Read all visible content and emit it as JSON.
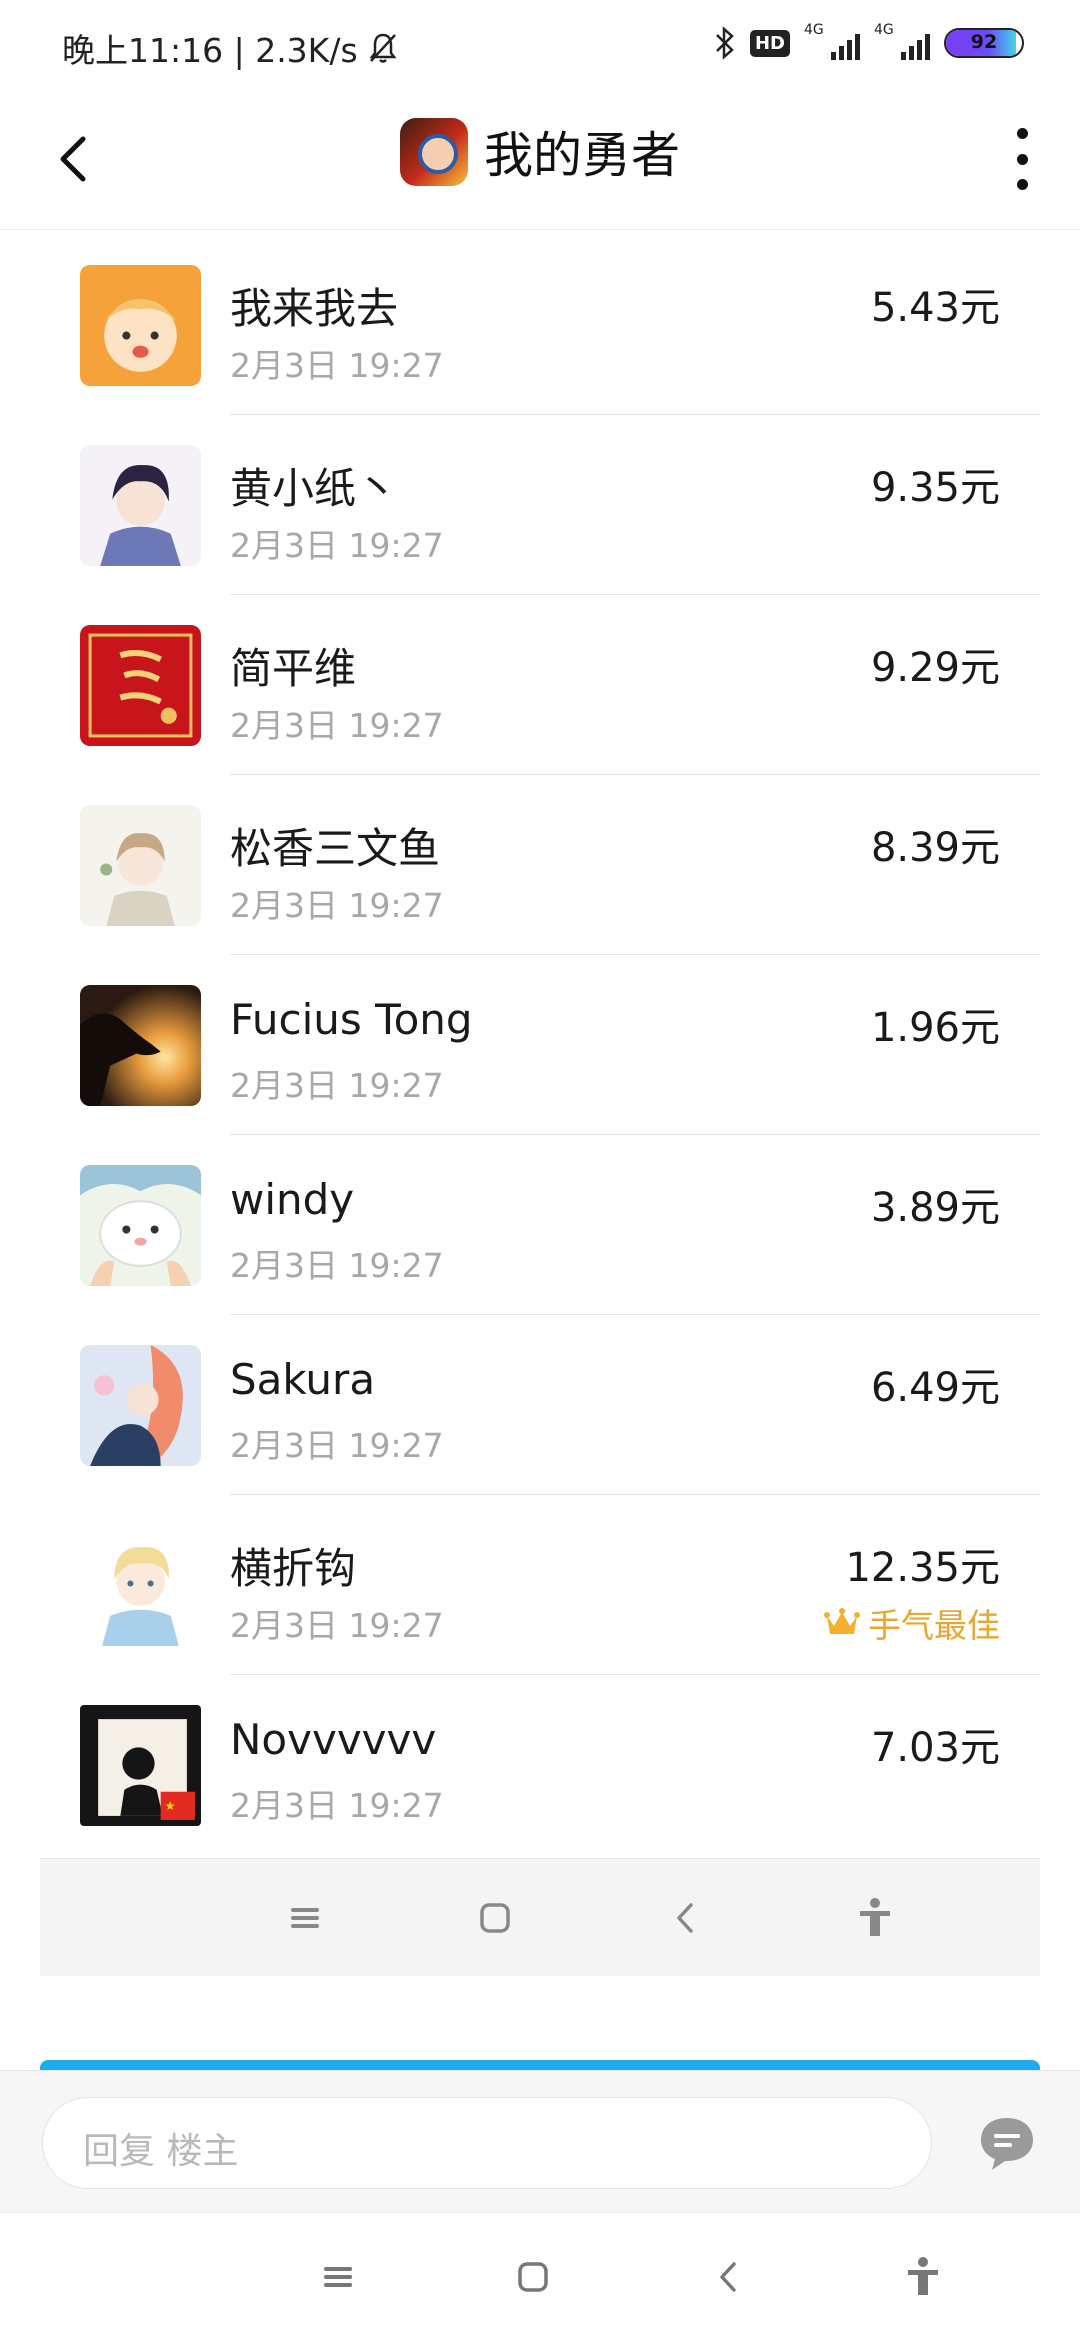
{
  "status_bar": {
    "time_speed": "晚上11:16 | 2.3K/s",
    "hd_label": "HD",
    "sim1_label": "4G",
    "sim2_label": "4G",
    "battery_level": "92",
    "icons": [
      "mute-bell-icon",
      "bluetooth-icon",
      "signal-icon",
      "battery-icon"
    ]
  },
  "header": {
    "title": "我的勇者",
    "back_icon": "chevron-left-icon",
    "more_icon": "more-vertical-icon"
  },
  "list": [
    {
      "name": "我来我去",
      "time": "2月3日  19:27",
      "amount": "5.43元"
    },
    {
      "name": "黄小纸丶",
      "time": "2月3日  19:27",
      "amount": "9.35元"
    },
    {
      "name": "简平维",
      "time": "2月3日  19:27",
      "amount": "9.29元"
    },
    {
      "name": "松香三文鱼",
      "time": "2月3日  19:27",
      "amount": "8.39元"
    },
    {
      "name": "Fucius Tong",
      "time": "2月3日  19:27",
      "amount": "1.96元"
    },
    {
      "name": "windy",
      "time": "2月3日  19:27",
      "amount": "3.89元"
    },
    {
      "name": "Sakura",
      "time": "2月3日  19:27",
      "amount": "6.49元"
    },
    {
      "name": "横折钩",
      "time": "2月3日  19:27",
      "amount": "12.35元",
      "badge": "手气最佳"
    },
    {
      "name": "Novvvvvv",
      "time": "2月3日  19:27",
      "amount": "7.03元"
    }
  ],
  "reply": {
    "placeholder": "回复  楼主"
  },
  "colors": {
    "accent_blue": "#1eaaf1",
    "best_badge": "#e9a62c",
    "secondary_text": "#a8a8a8"
  }
}
